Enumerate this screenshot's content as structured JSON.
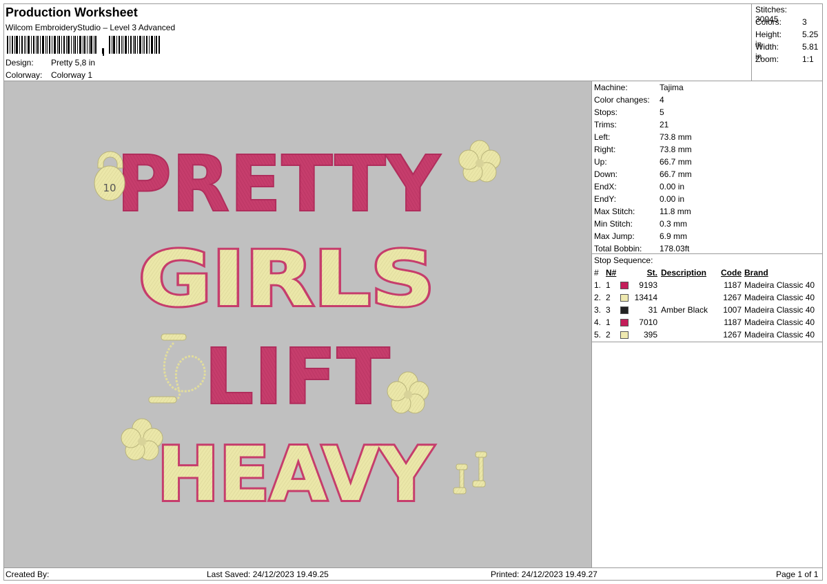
{
  "header": {
    "title": "Production Worksheet",
    "subtitle": "Wilcom EmbroideryStudio – Level 3 Advanced",
    "design_label": "Design:",
    "design_value": "Pretty 5,8 in",
    "colorway_label": "Colorway:",
    "colorway_value": "Colorway 1"
  },
  "stats": {
    "stitches_label": "Stitches:",
    "stitches": "30045",
    "colors_label": "Colors:",
    "colors": "3",
    "height_label": "Height:",
    "height": "5.25 in",
    "width_label": "Width:",
    "width": "5.81 in",
    "zoom_label": "Zoom:",
    "zoom": "1:1"
  },
  "machine": {
    "rows": [
      {
        "label": "Machine:",
        "value": "Tajima"
      },
      {
        "label": "Color changes:",
        "value": "4"
      },
      {
        "label": "Stops:",
        "value": "5"
      },
      {
        "label": "Trims:",
        "value": "21"
      },
      {
        "label": "Left:",
        "value": "73.8 mm"
      },
      {
        "label": "Right:",
        "value": "73.8 mm"
      },
      {
        "label": "Up:",
        "value": "66.7 mm"
      },
      {
        "label": "Down:",
        "value": "66.7 mm"
      },
      {
        "label": "EndX:",
        "value": "0.00 in"
      },
      {
        "label": "EndY:",
        "value": "0.00 in"
      },
      {
        "label": "Max Stitch:",
        "value": "11.8 mm"
      },
      {
        "label": "Min Stitch:",
        "value": "0.3 mm"
      },
      {
        "label": "Max Jump:",
        "value": "6.9 mm"
      },
      {
        "label": "Total Bobbin:",
        "value": "178.03ft"
      }
    ]
  },
  "sequence": {
    "title": "Stop Sequence:",
    "headers": {
      "n": "N#",
      "st": "St.",
      "desc": "Description",
      "code": "Code",
      "brand": "Brand"
    },
    "rows": [
      {
        "idx": "1.",
        "n": "1",
        "color": "#c41e5a",
        "st": "9193",
        "desc": "",
        "code": "1187",
        "brand": "Madeira Classic 40"
      },
      {
        "idx": "2.",
        "n": "2",
        "color": "#efe9b0",
        "st": "13414",
        "desc": "",
        "code": "1267",
        "brand": "Madeira Classic 40"
      },
      {
        "idx": "3.",
        "n": "3",
        "color": "#222222",
        "st": "31",
        "desc": "Amber Black",
        "code": "1007",
        "brand": "Madeira Classic 40"
      },
      {
        "idx": "4.",
        "n": "1",
        "color": "#c41e5a",
        "st": "7010",
        "desc": "",
        "code": "1187",
        "brand": "Madeira Classic 40"
      },
      {
        "idx": "5.",
        "n": "2",
        "color": "#efe9b0",
        "st": "395",
        "desc": "",
        "code": "1267",
        "brand": "Madeira Classic 40"
      }
    ]
  },
  "artwork": {
    "line1": "PRETTY",
    "line2": "GIRLS",
    "line3": "LIFT",
    "line4": "HEAVY",
    "weight_number": "10",
    "colors": {
      "pink": "#c63d6c",
      "cream": "#ebe7a9",
      "canvas": "#c0c0c0"
    }
  },
  "footer": {
    "created_by": "Created By:",
    "last_saved": "Last Saved: 24/12/2023 19.49.25",
    "printed": "Printed: 24/12/2023 19.49.27",
    "page": "Page 1 of 1"
  }
}
